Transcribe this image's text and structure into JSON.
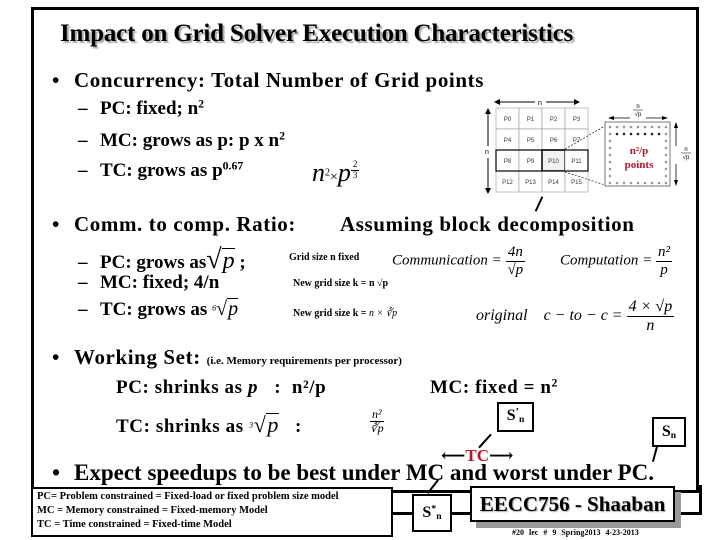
{
  "title": "Impact on Grid Solver Execution Characteristics",
  "concurrency": {
    "heading": "Concurrency:  Total Number of Grid points",
    "items": [
      {
        "label": "PC: fixed;  n",
        "sup": "2"
      },
      {
        "label": "MC: grows as p:   p x n",
        "sup": "2"
      },
      {
        "label": "TC: grows as p",
        "sup": "0.67"
      }
    ],
    "formula": {
      "base": "n",
      "base_exp": "2",
      "times": "×",
      "var": "p",
      "exp_num": "2",
      "exp_den": "3"
    }
  },
  "grid_figure": {
    "n_label": "n",
    "cells": [
      [
        "P0",
        "P1",
        "P2",
        "P3"
      ],
      [
        "P4",
        "P5",
        "P6",
        "P7"
      ],
      [
        "P8",
        "P9",
        "P10",
        "P11"
      ],
      [
        "P12",
        "P13",
        "P14",
        "P15"
      ]
    ],
    "highlighted_cell": "P10",
    "block_label_line1": "n²/p",
    "block_label_line2": "points",
    "block_side_num": "n",
    "block_side_den": "√p",
    "accent_color": "#b5162b"
  },
  "comm_ratio": {
    "heading": "Comm. to comp. Ratio:",
    "assumption": "Assuming block decomposition",
    "items": [
      {
        "label": "PC: grows as",
        "math": "p",
        "root": "",
        "suffix": ";",
        "note": "Grid size n fixed"
      },
      {
        "label": "MC: fixed;  4/n",
        "note": "New grid size k = n √p"
      },
      {
        "label": "TC:  grows as",
        "math": "p",
        "root": "6",
        "note_prefix": "New grid size k = ",
        "note_math": "n × ∛p"
      }
    ],
    "communication": {
      "label": "Communication =",
      "num": "4n",
      "den": "√p"
    },
    "computation": {
      "label": "Computation =",
      "num": "n²",
      "den": "p"
    },
    "original": {
      "label": "original",
      "lhs": "c − to − c =",
      "num": "4 × √p",
      "den": "n"
    }
  },
  "working_set": {
    "heading": "Working Set:",
    "note": "(i.e. Memory requirements per processor)",
    "pc": {
      "label": "PC: shrinks as",
      "var": "p",
      "sep": ":",
      "value": "n²/p"
    },
    "mc": {
      "label": "MC: fixed  =  n",
      "sup": "2"
    },
    "tc": {
      "label": "TC: shrinks as",
      "root": "3",
      "var": "p",
      "sep": ":",
      "num": "n²",
      "den": "∛p"
    }
  },
  "speedup_labels": {
    "s_prime": {
      "main": "S",
      "mark": "’",
      "sub": "n"
    },
    "s": {
      "main": "S",
      "sub": "n"
    },
    "s_star": {
      "main": "S",
      "mark": "*",
      "sub": "n"
    },
    "tc_range": "TC",
    "tc_color": "#b5162b"
  },
  "expectation": "Expect speedups to be best under MC and worst under PC.",
  "legend": [
    "PC= Problem constrained =  Fixed-load or fixed problem size model",
    "MC = Memory constrained = Fixed-memory Model",
    "TC = Time constrained =  Fixed-time Model"
  ],
  "brand": "EECC756 - Shaaban",
  "footer": "#20  lec # 9   Spring2013  4-23-2013"
}
